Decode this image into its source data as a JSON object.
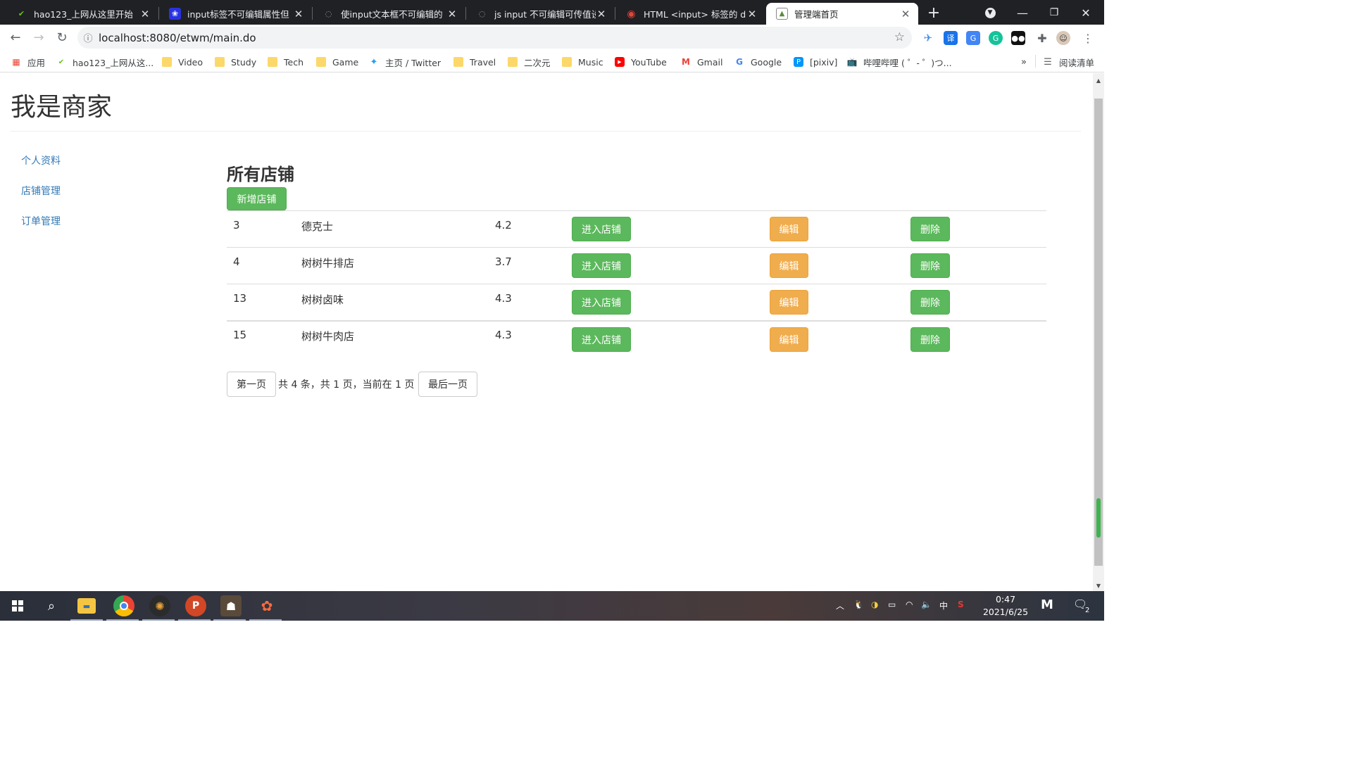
{
  "browser": {
    "tabs": [
      {
        "title": "hao123_上网从这里开始",
        "icon": "hao123-icon",
        "active": false
      },
      {
        "title": "input标签不可编辑属性但",
        "icon": "baidu-paw-icon",
        "active": false
      },
      {
        "title": "使input文本框不可编辑的",
        "icon": "loading-spinner-icon",
        "active": false
      },
      {
        "title": "js input 不可编辑可传值设",
        "icon": "loading-spinner-icon",
        "active": false
      },
      {
        "title": "HTML <input> 标签的 dis",
        "icon": "runoob-icon",
        "active": false
      },
      {
        "title": "管理端首页",
        "icon": "page-image-icon",
        "active": true
      }
    ],
    "new_tab": "+",
    "window_controls": {
      "minimize": "—",
      "restore": "❐",
      "close": "✕"
    },
    "url": "localhost:8080/etwm/main.do",
    "bookmarks": [
      {
        "label": "应用",
        "icon": "apps-grid-icon"
      },
      {
        "label": "hao123_上网从这...",
        "icon": "hao123-icon"
      },
      {
        "label": "Video",
        "icon": "folder-icon"
      },
      {
        "label": "Study",
        "icon": "folder-icon"
      },
      {
        "label": "Tech",
        "icon": "folder-icon"
      },
      {
        "label": "Game",
        "icon": "folder-icon"
      },
      {
        "label": "主页 / Twitter",
        "icon": "twitter-icon"
      },
      {
        "label": "Travel",
        "icon": "folder-icon"
      },
      {
        "label": "二次元",
        "icon": "folder-icon"
      },
      {
        "label": "Music",
        "icon": "folder-icon"
      },
      {
        "label": "YouTube",
        "icon": "youtube-icon"
      },
      {
        "label": "Gmail",
        "icon": "gmail-icon"
      },
      {
        "label": "Google",
        "icon": "google-icon"
      },
      {
        "label": "[pixiv]",
        "icon": "pixiv-icon"
      },
      {
        "label": "哔哩哔哩 ( ゜- ゜)つ...",
        "icon": "bilibili-icon"
      }
    ],
    "bookmarks_overflow": "»",
    "reading_list": "阅读清单"
  },
  "page": {
    "title": "我是商家",
    "sidebar": [
      "个人资料",
      "店铺管理",
      "订单管理"
    ],
    "section_title": "所有店铺",
    "add_button": "新增店铺",
    "shops": [
      {
        "id": "3",
        "name": "德克士",
        "rating": "4.2"
      },
      {
        "id": "4",
        "name": "树树牛排店",
        "rating": "3.7"
      },
      {
        "id": "13",
        "name": "树树卤味",
        "rating": "4.3"
      },
      {
        "id": "15",
        "name": "树树牛肉店",
        "rating": "4.3"
      }
    ],
    "row_actions": {
      "enter": "进入店铺",
      "edit": "编辑",
      "delete": "删除"
    },
    "pager": {
      "first": "第一页",
      "info": "共 4 条，共 1 页，当前在 1 页",
      "last": "最后一页"
    }
  },
  "taskbar": {
    "time": "0:47",
    "date": "2021/6/25",
    "ime": "中",
    "notifications": "2"
  }
}
